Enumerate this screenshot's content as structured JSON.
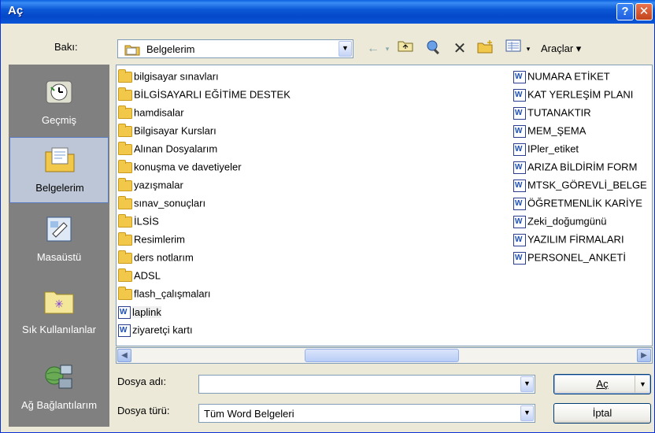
{
  "window": {
    "title": "Aç",
    "help_label": "?",
    "close_label": "✕"
  },
  "look_in": {
    "label": "Bakı:",
    "value": "Belgelerim"
  },
  "toolbar": {
    "tools_label": "Araçlar ▾"
  },
  "places": [
    {
      "label": "Geçmiş",
      "icon": "history-icon"
    },
    {
      "label": "Belgelerim",
      "icon": "my-documents-icon"
    },
    {
      "label": "Masaüstü",
      "icon": "desktop-icon"
    },
    {
      "label": "Sık Kullanılanlar",
      "icon": "favorites-icon"
    },
    {
      "label": "Ağ Bağlantılarım",
      "icon": "network-icon"
    }
  ],
  "files_col1": [
    {
      "name": "bilgisayar sınavları",
      "type": "folder"
    },
    {
      "name": "BİLGİSAYARLI EĞİTİME DESTEK",
      "type": "folder"
    },
    {
      "name": "hamdisalar",
      "type": "folder"
    },
    {
      "name": "Bilgisayar Kursları",
      "type": "folder"
    },
    {
      "name": "Alınan Dosyalarım",
      "type": "folder"
    },
    {
      "name": "konuşma ve davetiyeler",
      "type": "folder"
    },
    {
      "name": "yazışmalar",
      "type": "folder"
    },
    {
      "name": "sınav_sonuçları",
      "type": "folder"
    },
    {
      "name": "İLSİS",
      "type": "folder"
    },
    {
      "name": "Resimlerim",
      "type": "folder"
    },
    {
      "name": "ders notlarım",
      "type": "folder"
    },
    {
      "name": "ADSL",
      "type": "folder"
    },
    {
      "name": "flash_çalışmaları",
      "type": "folder"
    },
    {
      "name": "laplink",
      "type": "word"
    },
    {
      "name": "ziyaretçi kartı",
      "type": "word"
    }
  ],
  "files_col2": [
    {
      "name": "NUMARA ETİKET",
      "type": "word"
    },
    {
      "name": "KAT YERLEŞİM PLANI",
      "type": "word"
    },
    {
      "name": "TUTANAKTIR",
      "type": "word"
    },
    {
      "name": "MEM_ŞEMA",
      "type": "word"
    },
    {
      "name": "IPler_etiket",
      "type": "word"
    },
    {
      "name": "ARIZA BİLDİRİM FORM",
      "type": "word"
    },
    {
      "name": "MTSK_GÖREVLİ_BELGE",
      "type": "word"
    },
    {
      "name": "ÖĞRETMENLİK KARİYE",
      "type": "word"
    },
    {
      "name": "Zeki_doğumgünü",
      "type": "word"
    },
    {
      "name": "YAZILIM FİRMALARI",
      "type": "word"
    },
    {
      "name": "PERSONEL_ANKETİ",
      "type": "word"
    }
  ],
  "file_name": {
    "label": "Dosya adı:",
    "value": ""
  },
  "file_type": {
    "label": "Dosya türü:",
    "value": "Tüm Word Belgeleri"
  },
  "buttons": {
    "open": "Aç",
    "cancel": "İptal"
  }
}
